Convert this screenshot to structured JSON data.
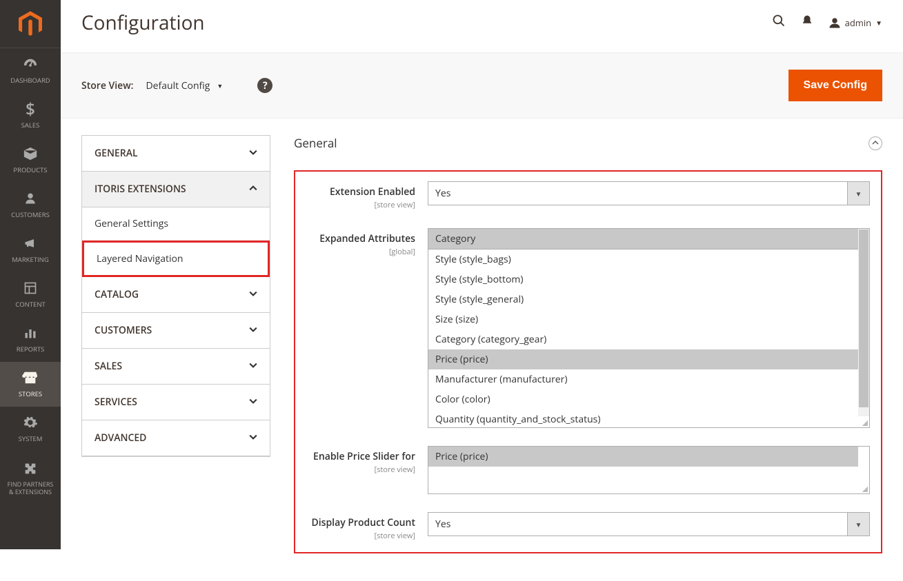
{
  "header": {
    "title": "Configuration",
    "username": "admin"
  },
  "toolbar": {
    "store_view_label": "Store View:",
    "store_view_value": "Default Config",
    "save_label": "Save Config"
  },
  "sidebar": {
    "items": [
      {
        "label": "DASHBOARD",
        "icon": "dashboard"
      },
      {
        "label": "SALES",
        "icon": "dollar"
      },
      {
        "label": "PRODUCTS",
        "icon": "box"
      },
      {
        "label": "CUSTOMERS",
        "icon": "person"
      },
      {
        "label": "MARKETING",
        "icon": "megaphone"
      },
      {
        "label": "CONTENT",
        "icon": "layout"
      },
      {
        "label": "REPORTS",
        "icon": "bars"
      },
      {
        "label": "STORES",
        "icon": "store",
        "active": true
      },
      {
        "label": "SYSTEM",
        "icon": "gear"
      },
      {
        "label": "FIND PARTNERS\n& EXTENSIONS",
        "icon": "puzzle",
        "partners": true
      }
    ]
  },
  "tabs": [
    {
      "label": "GENERAL",
      "expanded": false
    },
    {
      "label": "ITORIS EXTENSIONS",
      "expanded": true,
      "subs": [
        {
          "label": "General Settings",
          "active": false
        },
        {
          "label": "Layered Navigation",
          "active": true
        }
      ]
    },
    {
      "label": "CATALOG",
      "expanded": false
    },
    {
      "label": "CUSTOMERS",
      "expanded": false
    },
    {
      "label": "SALES",
      "expanded": false
    },
    {
      "label": "SERVICES",
      "expanded": false
    },
    {
      "label": "ADVANCED",
      "expanded": false
    }
  ],
  "section": {
    "title": "General",
    "fields": {
      "extension_enabled": {
        "label": "Extension Enabled",
        "scope": "[store view]",
        "value": "Yes"
      },
      "expanded_attributes": {
        "label": "Expanded Attributes",
        "scope": "[global]",
        "options": [
          {
            "text": "Category",
            "selected": true
          },
          {
            "text": "Style (style_bags)",
            "selected": false
          },
          {
            "text": "Style (style_bottom)",
            "selected": false
          },
          {
            "text": "Style (style_general)",
            "selected": false
          },
          {
            "text": "Size (size)",
            "selected": false
          },
          {
            "text": "Category (category_gear)",
            "selected": false
          },
          {
            "text": "Price (price)",
            "selected": true
          },
          {
            "text": "Manufacturer (manufacturer)",
            "selected": false
          },
          {
            "text": "Color (color)",
            "selected": false
          },
          {
            "text": "Quantity (quantity_and_stock_status)",
            "selected": false
          }
        ]
      },
      "price_slider": {
        "label": "Enable Price Slider for",
        "scope": "[store view]",
        "options": [
          {
            "text": "Price (price)",
            "selected": true
          }
        ]
      },
      "product_count": {
        "label": "Display Product Count",
        "scope": "[store view]",
        "value": "Yes"
      }
    }
  }
}
